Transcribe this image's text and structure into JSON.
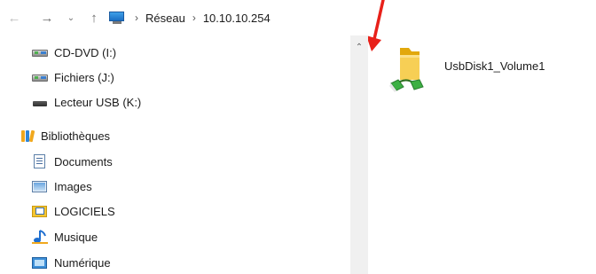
{
  "nav": {
    "back_icon": "back-arrow-icon",
    "forward_icon": "forward-arrow-icon",
    "recent_icon": "chevron-down-icon",
    "up_icon": "up-arrow-icon",
    "back_glyph": "←",
    "forward_glyph": "→",
    "recent_glyph": "⌄",
    "up_glyph": "↑"
  },
  "address": {
    "root_icon": "computer-icon",
    "separator": "›",
    "segments": [
      "Réseau",
      "10.10.10.254"
    ]
  },
  "sidebar": {
    "items": [
      {
        "label": "CD-DVD (I:)",
        "icon": "network-drive-icon"
      },
      {
        "label": "Fichiers (J:)",
        "icon": "network-drive-icon"
      },
      {
        "label": "Lecteur USB (K:)",
        "icon": "usb-drive-icon"
      },
      {
        "label": "Bibliothèques",
        "icon": "libraries-icon"
      },
      {
        "label": "Documents",
        "icon": "documents-icon"
      },
      {
        "label": "Images",
        "icon": "pictures-icon"
      },
      {
        "label": "LOGICIELS",
        "icon": "library-folder-icon"
      },
      {
        "label": "Musique",
        "icon": "music-icon"
      },
      {
        "label": "Numérique",
        "icon": "digital-icon"
      }
    ]
  },
  "scrollbar": {
    "up_glyph": "⌃"
  },
  "content": {
    "items": [
      {
        "label": "UsbDisk1_Volume1",
        "icon": "shared-folder-icon"
      }
    ]
  },
  "colors": {
    "annotation_arrow": "#e8211a",
    "folder": "#f4c430",
    "share_green": "#3cb043"
  }
}
